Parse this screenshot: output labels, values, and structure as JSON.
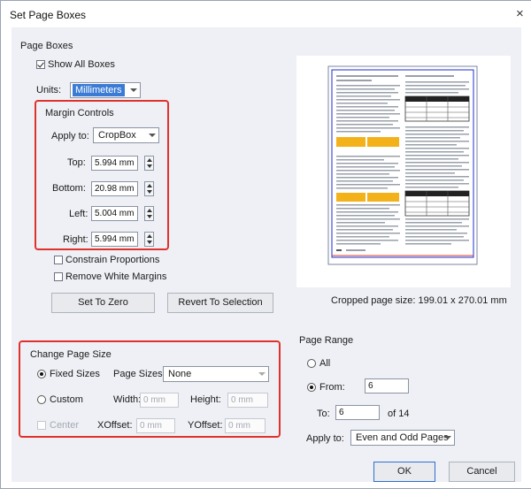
{
  "window": {
    "title": "Set Page Boxes",
    "close_glyph": "×"
  },
  "page_boxes": {
    "group_label": "Page Boxes",
    "show_all_boxes": {
      "label": "Show All Boxes",
      "checked": true
    },
    "units_label": "Units:",
    "units_value": "Millimeters"
  },
  "margin_controls": {
    "group_label": "Margin Controls",
    "apply_to_label": "Apply to:",
    "apply_to_value": "CropBox",
    "top_label": "Top:",
    "top_value": "5.994 mm",
    "bottom_label": "Bottom:",
    "bottom_value": "20.98 mm",
    "left_label": "Left:",
    "left_value": "5.004 mm",
    "right_label": "Right:",
    "right_value": "5.994 mm"
  },
  "options": {
    "constrain_proportions": {
      "label": "Constrain Proportions",
      "checked": false
    },
    "remove_white_margins": {
      "label": "Remove White Margins",
      "checked": false
    }
  },
  "buttons": {
    "set_to_zero": "Set To Zero",
    "revert_to_selection": "Revert To Selection",
    "ok": "OK",
    "cancel": "Cancel"
  },
  "preview": {
    "cropped_size": "Cropped page size: 199.01 x 270.01 mm"
  },
  "change_page_size": {
    "group_label": "Change Page Size",
    "fixed_sizes_label": "Fixed Sizes",
    "page_sizes_label": "Page Sizes:",
    "page_sizes_value": "None",
    "custom_label": "Custom",
    "width_label": "Width:",
    "width_value": "0 mm",
    "height_label": "Height:",
    "height_value": "0 mm",
    "center_label": "Center",
    "xoffset_label": "XOffset:",
    "xoffset_value": "0 mm",
    "yoffset_label": "YOffset:",
    "yoffset_value": "0 mm",
    "selected": "Fixed Sizes"
  },
  "page_range": {
    "group_label": "Page Range",
    "all_label": "All",
    "from_label": "From:",
    "from_value": "6",
    "to_label": "To:",
    "to_value": "6",
    "of_text": "of 14",
    "apply_to_label": "Apply to:",
    "apply_to_value": "Even and Odd Pages",
    "selected": "From"
  },
  "colors": {
    "highlight_red": "#e0322d",
    "units_select_blue": "#3a7bd5",
    "dialog_bg": "#eef0f5"
  }
}
